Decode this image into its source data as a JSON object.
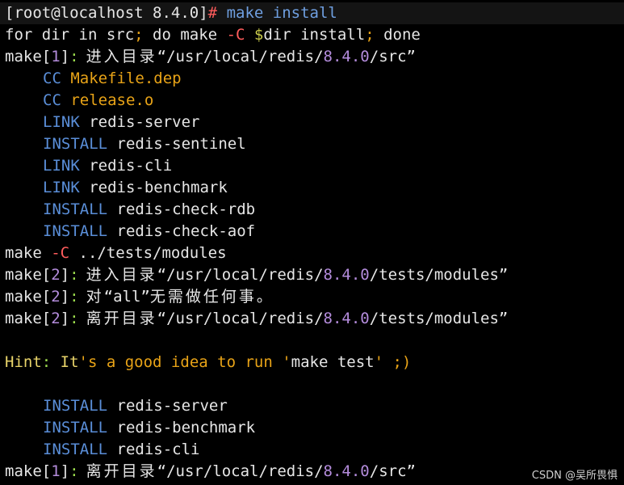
{
  "prompt": {
    "open": "[root@localhost 8.4.0]",
    "hash": "#",
    "command": "make install"
  },
  "lines": {
    "l1": {
      "a": "for dir in src",
      "semi1": ";",
      "b": " do make ",
      "flag": "-C",
      "dollar": " $",
      "c": "dir install",
      "semi2": ";",
      "d": " done"
    },
    "l2": {
      "make": "make",
      "lb": "[",
      "num": "1",
      "rb": "]",
      "colon": ":",
      "cjk": " 进入目录",
      "q1": "“",
      "path1": "/usr/local/redis/",
      "ver": "8.4.0",
      "path2": "/src",
      "q2": "”"
    },
    "l3": {
      "tag": "CC",
      "file": "Makefile.dep"
    },
    "l4": {
      "tag": "CC",
      "file": "release.o"
    },
    "l5": {
      "tag": "LINK",
      "target": "redis-server"
    },
    "l6": {
      "tag": "INSTALL",
      "target": "redis-sentinel"
    },
    "l7": {
      "tag": "LINK",
      "target": "redis-cli"
    },
    "l8": {
      "tag": "LINK",
      "target": "redis-benchmark"
    },
    "l9": {
      "tag": "INSTALL",
      "target": "redis-check-rdb"
    },
    "l10": {
      "tag": "INSTALL",
      "target": "redis-check-aof"
    },
    "l11": {
      "make": "make ",
      "flag": "-C",
      "path": " ../tests/modules"
    },
    "l12": {
      "make": "make",
      "lb": "[",
      "num": "2",
      "rb": "]",
      "colon": ":",
      "cjk": " 进入目录",
      "q1": "“",
      "path1": "/usr/local/redis/",
      "ver": "8.4.0",
      "path2": "/tests/modules",
      "q2": "”"
    },
    "l13": {
      "make": "make",
      "lb": "[",
      "num": "2",
      "rb": "]",
      "colon": ":",
      "cjk1": " 对",
      "q1": "“",
      "word": "all",
      "q2": "”",
      "cjk2": "无需做任何事。"
    },
    "l14": {
      "make": "make",
      "lb": "[",
      "num": "2",
      "rb": "]",
      "colon": ":",
      "cjk": " 离开目录",
      "q1": "“",
      "path1": "/usr/local/redis/",
      "ver": "8.4.0",
      "path2": "/tests/modules",
      "q2": "”"
    },
    "l15": {
      "hint": "Hint",
      "colon": ":",
      "t1": " It",
      "t2": "'s a good idea to run '",
      "t3": "make test",
      "t4": "' ;)"
    },
    "l16": {
      "tag": "INSTALL",
      "target": "redis-server"
    },
    "l17": {
      "tag": "INSTALL",
      "target": "redis-benchmark"
    },
    "l18": {
      "tag": "INSTALL",
      "target": "redis-cli"
    },
    "l19": {
      "make": "make",
      "lb": "[",
      "num": "1",
      "rb": "]",
      "colon": ":",
      "cjk": " 离开目录",
      "q1": "“",
      "path1": "/usr/local/redis/",
      "ver": "8.4.0",
      "path2": "/src",
      "q2": "”"
    }
  },
  "watermark": "CSDN @吴所畏惧",
  "colors": {
    "background": "#000000",
    "text": "#e6e6e6",
    "green": "#9bdb4d",
    "purple": "#b48cdc",
    "blue": "#5a8ed8",
    "orange": "#e8a317",
    "red": "#ff5c5c"
  }
}
